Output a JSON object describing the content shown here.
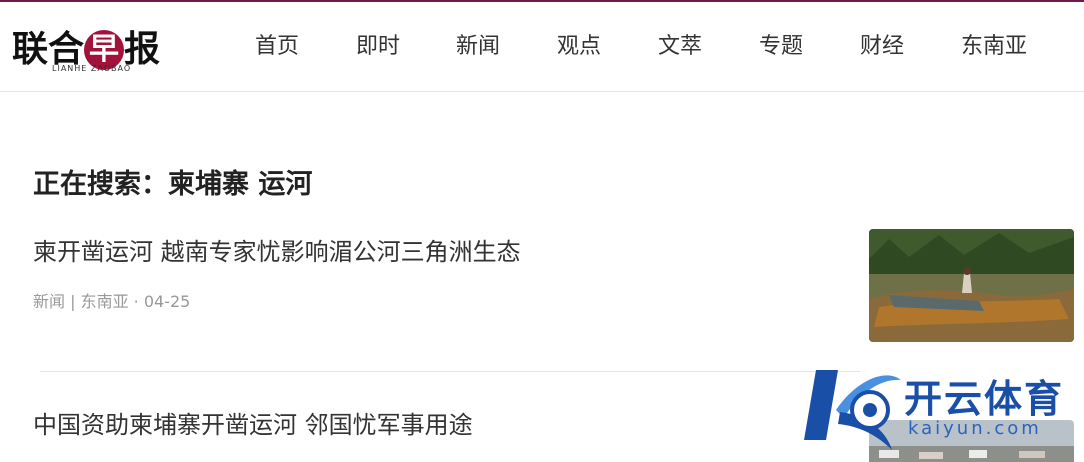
{
  "logo": {
    "main": "联合早报",
    "sub": "LIANHE ZAOBAO"
  },
  "nav": [
    "首页",
    "即时",
    "新闻",
    "观点",
    "文萃",
    "专题",
    "财经",
    "东南亚"
  ],
  "search": {
    "heading": "正在搜索：柬埔寨 运河"
  },
  "results": [
    {
      "title": "柬开凿运河 越南专家忧影响湄公河三角洲生态",
      "meta": "新闻 | 东南亚 · 04-25"
    },
    {
      "title": "中国资助柬埔寨开凿运河 邻国忧军事用途",
      "meta": ""
    }
  ],
  "watermark": {
    "name": "开云体育",
    "url": "kaiyun.com"
  },
  "colors": {
    "brand": "#a3123a",
    "topline": "#6b1d4a",
    "watermark": "#1a4fa8"
  }
}
